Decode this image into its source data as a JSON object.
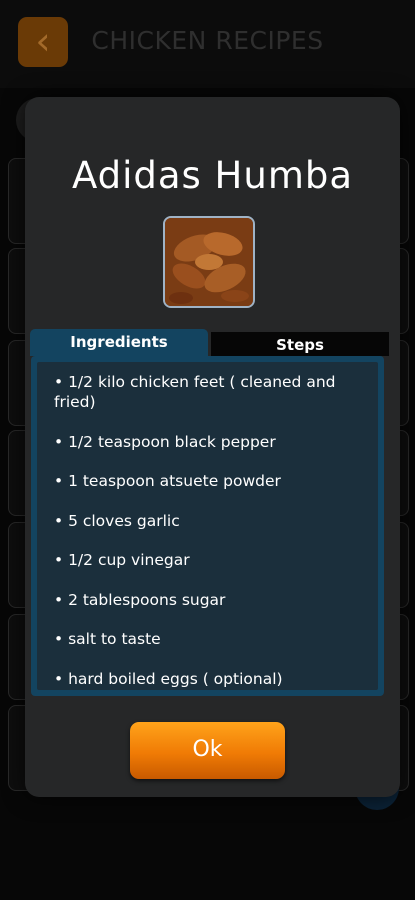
{
  "appbar": {
    "back_icon": "chevron-left-icon",
    "title": "CHICKEN RECIPES"
  },
  "colors": {
    "accent_orange": "#f28c0f",
    "tab_blue": "#134460",
    "panel_bg": "#1b2f3c",
    "dialog_bg": "#262728"
  },
  "dialog": {
    "title": "Adidas Humba",
    "image_alt": "dish photo",
    "tabs": [
      {
        "label": "Ingredients",
        "selected": true
      },
      {
        "label": "Steps",
        "selected": false
      }
    ],
    "ingredients": [
      "• 1/2 kilo chicken feet ( cleaned and fried)",
      "• 1/2 teaspoon black pepper",
      "• 1 teaspoon atsuete powder",
      "• 5 cloves garlic",
      "• 1/2 cup vinegar",
      "• 2 tablespoons sugar",
      "• salt to taste",
      "• hard boiled eggs ( optional)"
    ],
    "ok_label": "Ok"
  }
}
